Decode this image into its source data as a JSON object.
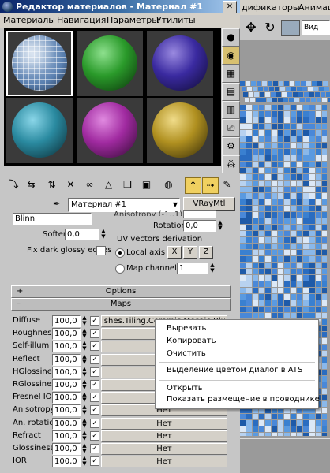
{
  "window": {
    "title": "Редактор материалов - Материал #1"
  },
  "menu": [
    "Материалы",
    "Навигация",
    "Параметры",
    "Утилиты"
  ],
  "viewport_menu": [
    "дификаторы",
    "Анимац"
  ],
  "viewport_view_select": "Вид",
  "material": {
    "name": "Материал #1",
    "type": "VRayMtl",
    "shader": "Blinn",
    "partial_label": "Anisotropy (-1..1)"
  },
  "params": {
    "rotation_label": "Rotation",
    "rotation_value": "0,0",
    "soften_label": "Soften",
    "soften_value": "0,0",
    "fix_dark_label": "Fix dark glossy edges",
    "uv_group_label": "UV vectors derivation",
    "local_axis_label": "Local axis",
    "axis_x": "X",
    "axis_y": "Y",
    "axis_z": "Z",
    "map_channel_label": "Map channel",
    "map_channel_value": "1"
  },
  "rollouts": {
    "options_label": "Options",
    "options_sign": "+",
    "maps_label": "Maps",
    "maps_sign": "–"
  },
  "maps": [
    {
      "label": "Diffuse",
      "amount": "100,0",
      "map": "ishes.Tiling.Ceramic.Mosaic.Bluish"
    },
    {
      "label": "Roughness",
      "amount": "100,0",
      "map": ""
    },
    {
      "label": "Self-illum",
      "amount": "100,0",
      "map": ""
    },
    {
      "label": "Reflect",
      "amount": "100,0",
      "map": ""
    },
    {
      "label": "HGlossiness",
      "amount": "100,0",
      "map": ""
    },
    {
      "label": "RGlossiness",
      "amount": "100,0",
      "map": ""
    },
    {
      "label": "Fresnel IOR",
      "amount": "100,0",
      "map": ""
    },
    {
      "label": "Anisotropy",
      "amount": "100,0",
      "map": "Нет"
    },
    {
      "label": "An. rotation",
      "amount": "100,0",
      "map": "Нет"
    },
    {
      "label": "Refract",
      "amount": "100,0",
      "map": "Нет"
    },
    {
      "label": "Glossiness",
      "amount": "100,0",
      "map": "Нет"
    },
    {
      "label": "IOR",
      "amount": "100,0",
      "map": "Нет"
    }
  ],
  "context_menu": {
    "cut": "Вырезать",
    "copy": "Копировать",
    "clear": "Очистить",
    "highlight": "Выделение цветом диалог в ATS",
    "open": "Открыть",
    "show_location": "Показать размещение в проводнике"
  },
  "colors": {
    "slot_spheres": [
      "#9cb4d0",
      "#2a9a2a",
      "#3a2aa0",
      "#2a8aa0",
      "#a02aa0",
      "#b09020"
    ],
    "tile_blue": "#3a78c8",
    "tile_light": "#c8dcf2"
  }
}
